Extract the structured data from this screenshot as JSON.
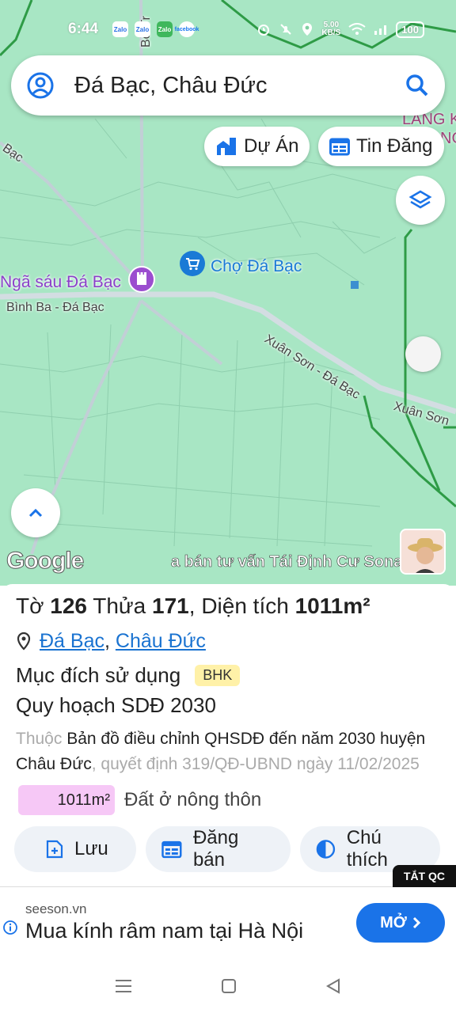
{
  "status_bar": {
    "time": "6:44",
    "app_icons": [
      "Zalo",
      "Zalo",
      "Zalo",
      "facebook"
    ],
    "net_speed_value": "5.00",
    "net_speed_unit": "KB/S",
    "battery": "100"
  },
  "search": {
    "text": "Đá Bạc, Châu Đức"
  },
  "chips": {
    "projects": "Dự Án",
    "listings": "Tin Đăng"
  },
  "map": {
    "road_top": "Bờ Tr",
    "road_left": "Bạc",
    "area_top_right_1": "LÀNG K",
    "area_top_right_2": "NG",
    "poi_market": "Chợ Đá Bạc",
    "poi_junction": "Ngã sáu Đá Bạc",
    "road_binh_ba": "Bình Ba - Đá Bạc",
    "road_xuan_son": "Xuân Sơn - Đá Bạc",
    "road_xuan_son_2": "Xuân Sơn",
    "google_logo": "Google",
    "marquee": "a bán tư vấn Tái Định Cư Sonad"
  },
  "parcel": {
    "sheet_label": "Tờ",
    "sheet_no": "126",
    "plot_label": "Thửa",
    "plot_no": "171",
    "area_label": "Diện tích",
    "area_value": "1011m²",
    "ward": "Đá Bạc",
    "district": "Châu Đức",
    "purpose_label": "Mục đích sử dụng",
    "purpose_code": "BHK",
    "plan_title": "Quy hoạch SDĐ 2030",
    "belongs_prefix": "Thuộc",
    "plan_doc": "Bản đồ điều chỉnh QHSDĐ đến năm 2030 huyện Châu Đức",
    "decision": ", quyết định 319/QĐ-UBND ngày 11/02/2025",
    "zone_area": "1011m²",
    "zone_name": "Đất ở nông thôn"
  },
  "actions": {
    "save": "Lưu",
    "post": "Đăng bán",
    "legend": "Chú thích"
  },
  "ad": {
    "close_label": "TẮT QC",
    "source": "seeson.vn",
    "title": "Mua kính râm nam tại Hà Nội",
    "cta": "MỞ"
  },
  "colors": {
    "map_bg": "#a8e6c4",
    "accent_blue": "#1a73e8",
    "zone_pink": "#f6c8f6",
    "badge_yellow": "#fff1a8"
  }
}
